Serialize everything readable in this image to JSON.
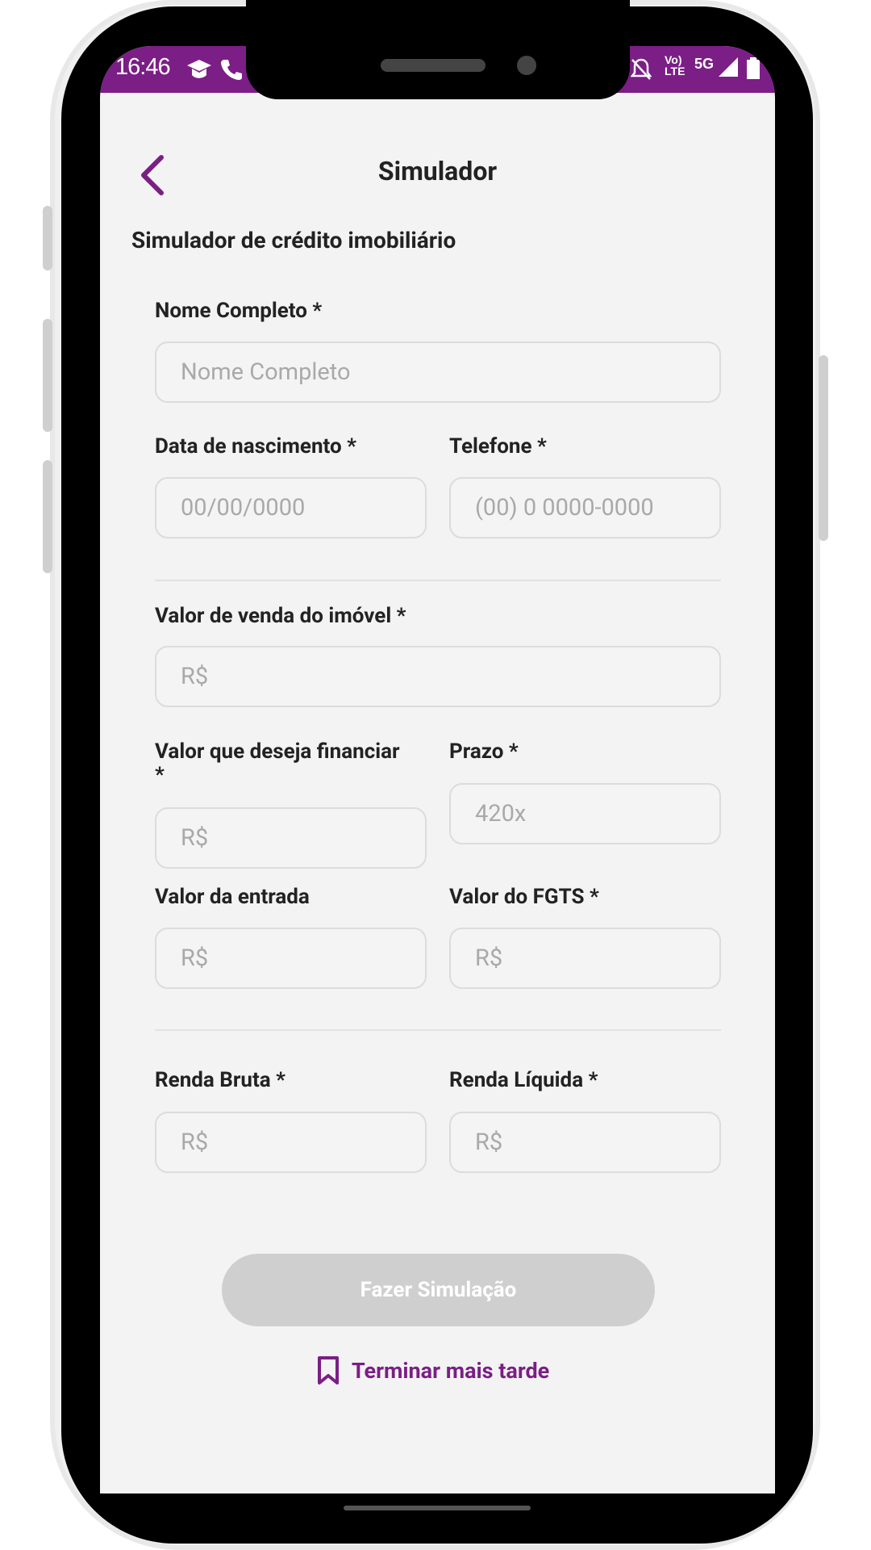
{
  "status_bar": {
    "time": "16:46",
    "network": "Vo) LTE",
    "signal": "5G"
  },
  "header": {
    "title": "Simulador"
  },
  "section": {
    "title": "Simulador de crédito imobiliário"
  },
  "form": {
    "nome": {
      "label": "Nome Completo *",
      "placeholder": "Nome Completo"
    },
    "nascimento": {
      "label": "Data de nascimento *",
      "placeholder": "00/00/0000"
    },
    "telefone": {
      "label": "Telefone *",
      "placeholder": "(00) 0 0000-0000"
    },
    "valor_venda": {
      "label": "Valor de venda do imóvel *",
      "placeholder": "R$"
    },
    "valor_financiar": {
      "label_line1": "Valor que deseja financiar",
      "label_line2": "*",
      "placeholder": "R$"
    },
    "prazo": {
      "label": "Prazo *",
      "placeholder": "420x"
    },
    "valor_entrada": {
      "label": "Valor da entrada",
      "placeholder": "R$"
    },
    "valor_fgts": {
      "label": "Valor do FGTS *",
      "placeholder": "R$"
    },
    "renda_bruta": {
      "label": "Renda Bruta *",
      "placeholder": "R$"
    },
    "renda_liquida": {
      "label": "Renda Líquida *",
      "placeholder": "R$"
    }
  },
  "actions": {
    "simulate_label": "Fazer Simulação",
    "later_label": "Terminar mais tarde"
  },
  "colors": {
    "accent": "#7b1e86",
    "disabled_button": "#cfcfcf"
  }
}
